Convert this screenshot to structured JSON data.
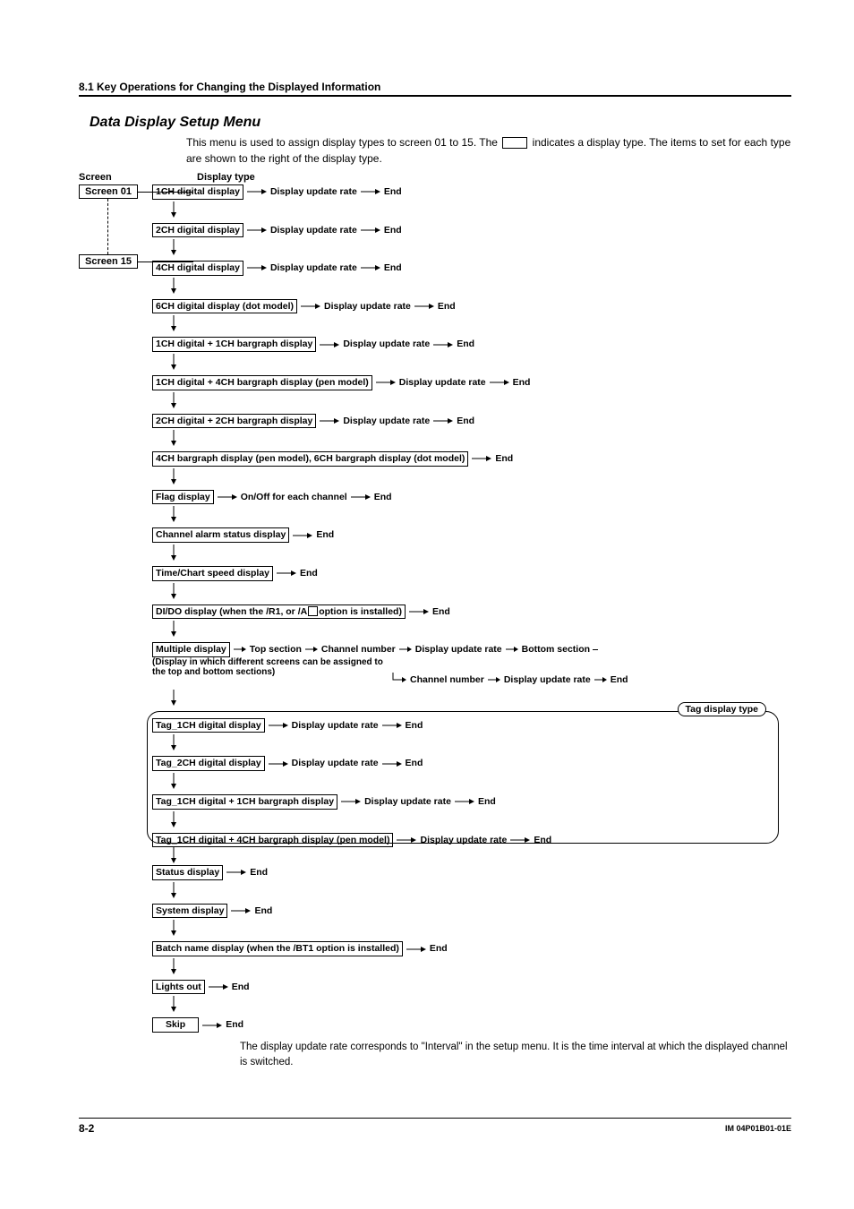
{
  "section_header": "8.1  Key Operations for Changing the Displayed Information",
  "subtitle": "Data Display Setup Menu",
  "intro_pre": "This menu is used to assign display types to screen 01 to 15. The ",
  "intro_post": " indicates a display type. The items to set for each type are shown to the right of the display type.",
  "col_screen": "Screen",
  "col_type": "Display type",
  "screen01": "Screen 01",
  "screen15": "Screen 15",
  "dur": "Display update rate",
  "end": "End",
  "types": {
    "t1": "1CH digital display",
    "t2": "2CH digital display",
    "t3": "4CH digital display",
    "t4": "6CH digital display (dot model)",
    "t5": "1CH digital + 1CH bargraph display",
    "t6": "1CH digital + 4CH bargraph display (pen model)",
    "t7": "2CH digital + 2CH bargraph display",
    "t8": "4CH bargraph display (pen model), 6CH bargraph display (dot model)",
    "t9": "Flag display",
    "t9opt": "On/Off for each channel",
    "t10": "Channel alarm status display",
    "t11": "Time/Chart speed display",
    "t12a": "DI/DO display (when the /R1, or /A",
    "t12b": "option is installed)",
    "t13": "Multiple display",
    "t13_top": "Top section",
    "t13_ch": "Channel number",
    "t13_bot": "Bottom section",
    "t13_note": "(Display in which different screens can be assigned to the top and bottom sections)",
    "tag_badge": "Tag display type",
    "tag1": "Tag_1CH digital display",
    "tag2": "Tag_2CH digital display",
    "tag3": "Tag_1CH digital + 1CH bargraph display",
    "tag4": "Tag_1CH digital + 4CH bargraph display (pen model)",
    "t14": "Status display",
    "t15": "System display",
    "t16": "Batch name display (when the /BT1 option is installed)",
    "t17": "Lights out",
    "t18": "Skip"
  },
  "foot_note": "The display update rate corresponds to \"Interval\" in the setup menu. It is the time interval at which the displayed channel is switched.",
  "page_num": "8-2",
  "doc_id": "IM 04P01B01-01E"
}
